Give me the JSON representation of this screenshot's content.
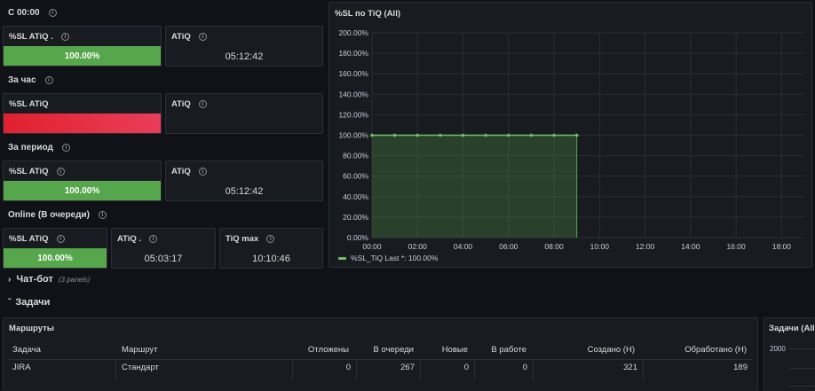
{
  "rows": {
    "since_midnight": "С 00:00",
    "per_hour": "За час",
    "per_period": "За период",
    "online": "Online (В очереди)"
  },
  "panels": {
    "sl1": {
      "title": "%SL ATiQ .",
      "value": "100.00%"
    },
    "at1": {
      "title": "ATiQ",
      "value": "05:12:42"
    },
    "sl2": {
      "title": "%SL ATiQ",
      "value": ""
    },
    "at2": {
      "title": "ATiQ",
      "value": ""
    },
    "sl3": {
      "title": "%SL ATiQ",
      "value": "100.00%"
    },
    "at3": {
      "title": "ATiQ",
      "value": "05:12:42"
    },
    "sl4": {
      "title": "%SL ATiQ",
      "value": "100.00%"
    },
    "at4": {
      "title": "ATiQ .",
      "value": "05:03:17"
    },
    "tiqmax": {
      "title": "TiQ max",
      "value": "10:10:46"
    }
  },
  "collapsed_row": {
    "label": "Чат-бот",
    "sub": "(3 panels)"
  },
  "tasks_row": {
    "label": "Задачи"
  },
  "table_panel": {
    "title": "Маршруты",
    "columns": [
      "Задача",
      "Маршрут",
      "Отложены",
      "В очереди",
      "Новые",
      "В работе",
      "Создано (Н)",
      "Обработано (Н)"
    ],
    "rows": [
      [
        "JIRA",
        "Стандарт",
        "0",
        "267",
        "0",
        "0",
        "321",
        "189"
      ]
    ]
  },
  "tasks_chart": {
    "title": "Задачи (All",
    "y_label": "2000"
  },
  "colors": {
    "green": "#56a64b",
    "red": "#e0202e",
    "bg": "#111217",
    "panel": "#181b1f"
  },
  "chart_data": {
    "type": "area",
    "title": "%SL по TiQ (All)",
    "series": [
      {
        "name": "%SL_TiQ",
        "x": [
          "00:00",
          "01:00",
          "02:00",
          "03:00",
          "04:00",
          "05:00",
          "06:00",
          "07:00",
          "08:00",
          "09:00"
        ],
        "values": [
          100,
          100,
          100,
          100,
          100,
          100,
          100,
          100,
          100,
          100
        ]
      }
    ],
    "y_ticks": [
      "0.00%",
      "20.00%",
      "40.00%",
      "60.00%",
      "80.00%",
      "100.00%",
      "120.00%",
      "140.00%",
      "160.00%",
      "180.00%",
      "200.00%"
    ],
    "x_ticks": [
      "00:00",
      "02:00",
      "04:00",
      "06:00",
      "08:00",
      "10:00",
      "12:00",
      "14:00",
      "16:00",
      "18:00"
    ],
    "ylim": [
      0,
      200
    ],
    "xlim_hours": [
      0,
      19
    ],
    "legend": "%SL_TiQ  Last *: 100.00%",
    "legend_position": "bottom-left",
    "grid": true
  }
}
